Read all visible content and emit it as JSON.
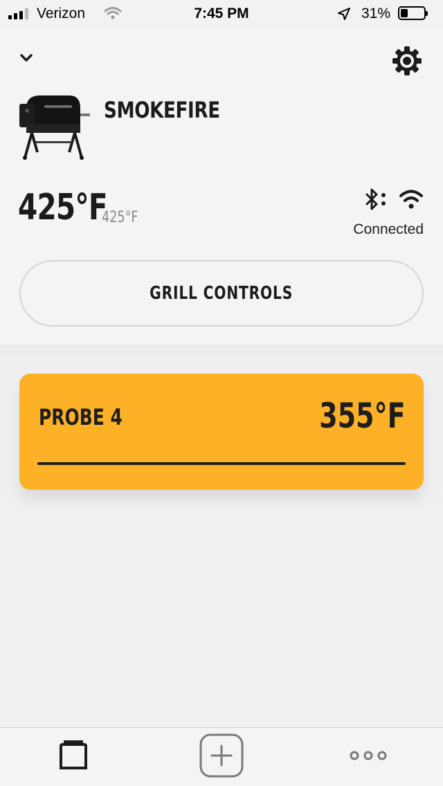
{
  "status_bar": {
    "carrier": "Verizon",
    "time": "7:45 PM",
    "battery_percent": "31%",
    "battery_level": 0.31,
    "signal_bars": 3,
    "signal_bars_total": 4,
    "icons": [
      "signal-icon",
      "wifi-icon",
      "location-arrow-icon",
      "battery-icon"
    ]
  },
  "header": {
    "collapse_icon": "chevron-down-icon",
    "settings_icon": "gear-icon"
  },
  "grill": {
    "name": "SMOKEFIRE",
    "image": "grill-image",
    "current_temp": "425°F",
    "target_temp": "425°F",
    "connection_icons": [
      "bluetooth-icon",
      "wifi-icon"
    ],
    "connection_status": "Connected"
  },
  "controls": {
    "grill_controls_label": "GRILL CONTROLS"
  },
  "probes": [
    {
      "name": "PROBE 4",
      "temp": "355°F",
      "color": "#fcb127",
      "progress": 1.0
    }
  ],
  "tab_bar": {
    "items": [
      {
        "icon": "cards-icon"
      },
      {
        "icon": "add-icon"
      },
      {
        "icon": "more-icon"
      }
    ]
  },
  "colors": {
    "accent_probe": "#fcb127",
    "background": "#f2f2f2",
    "text": "#1b1b1b",
    "muted_text": "#8a8a8a"
  }
}
